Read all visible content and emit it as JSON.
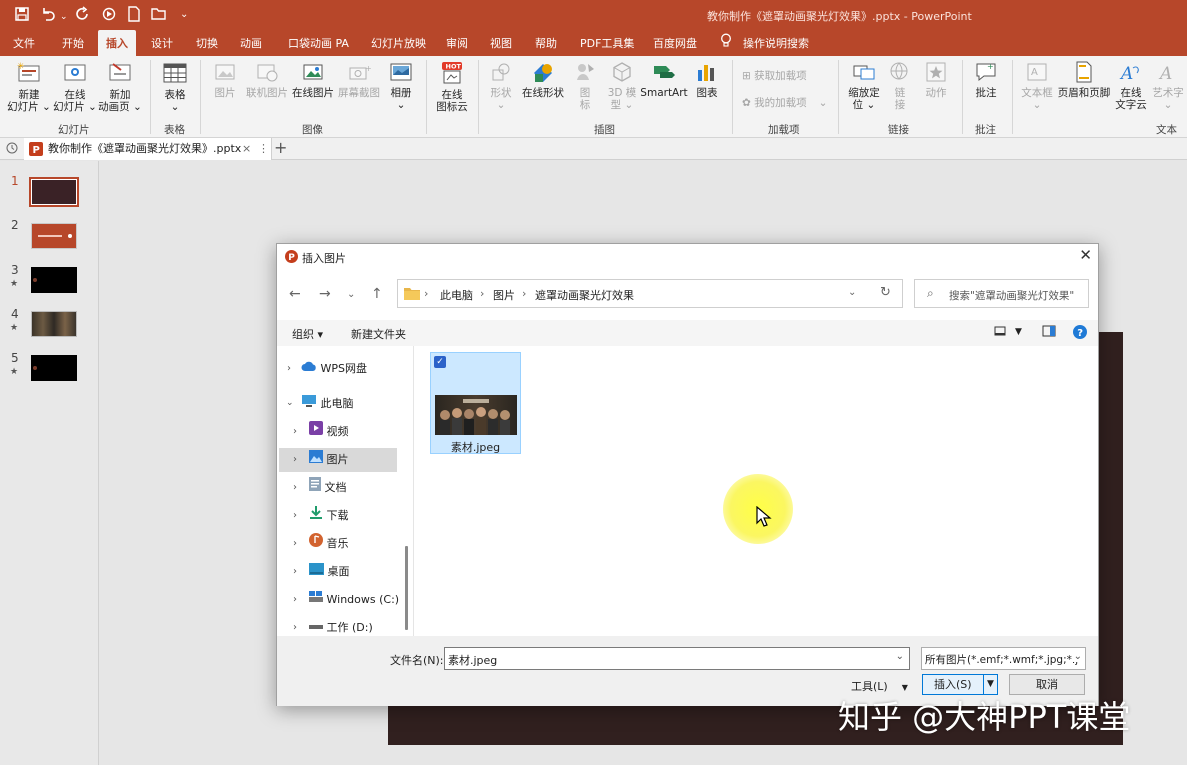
{
  "window": {
    "title": "教你制作《遮罩动画聚光灯效果》.pptx  -  PowerPoint",
    "accent": "#b7472a"
  },
  "quick_access": [
    {
      "icon": "save-icon",
      "glyph": "🖫"
    },
    {
      "icon": "undo-icon",
      "glyph": "↶"
    },
    {
      "icon": "redo-icon",
      "glyph": "↻"
    },
    {
      "icon": "from-beginning-icon",
      "glyph": "⟲"
    },
    {
      "icon": "new-file-icon",
      "glyph": "🗋"
    },
    {
      "icon": "open-folder-icon",
      "glyph": "🗁"
    },
    {
      "icon": "customize-icon",
      "glyph": "⌄"
    }
  ],
  "tabs": [
    "文件",
    "开始",
    "插入",
    "设计",
    "切换",
    "动画",
    "口袋动画 PA",
    "幻灯片放映",
    "审阅",
    "视图",
    "帮助",
    "PDF工具集",
    "百度网盘",
    "操作说明搜索"
  ],
  "active_tab": "插入",
  "ribbon": {
    "buttons": {
      "new_slide": "新建\n幻灯片 ⌄",
      "online_slide": "在线\n幻灯片 ⌄",
      "new_anim_page": "新加\n动画页 ⌄",
      "table": "表格\n⌄",
      "picture": "图片",
      "online_picture_linked": "联机图片",
      "online_picture": "在线图片",
      "screenshot": "屏幕截图",
      "album": "相册\n⌄",
      "online_icon_cloud": "在线\n图标云",
      "shapes": "形状\n⌄",
      "online_shapes": "在线形状",
      "icons": "图\n标",
      "model3d": "3D 模\n型 ⌄",
      "smartart": "SmartArt",
      "chart": "图表",
      "get_addins": "获取加载项",
      "my_addins": "我的加载项",
      "zoom": "缩放定\n位 ⌄",
      "link": "链\n接",
      "action": "动作",
      "comment": "批注",
      "textbox": "文本框\n⌄",
      "header_footer": "页眉和页脚",
      "online_wordart": "在线\n文字云",
      "wordart": "艺术字\n⌄"
    },
    "groups": [
      "幻灯片",
      "表格",
      "图像",
      "插图",
      "加载项",
      "链接",
      "批注",
      "文本"
    ],
    "hot_badge": "HOT"
  },
  "document_tab": {
    "label": "教你制作《遮罩动画聚光灯效果》.pptx",
    "close": "×",
    "more": "⋮",
    "add": "+"
  },
  "slides": [
    {
      "num": "1",
      "star": ""
    },
    {
      "num": "2",
      "star": ""
    },
    {
      "num": "3",
      "star": "★"
    },
    {
      "num": "4",
      "star": "★"
    },
    {
      "num": "5",
      "star": "★"
    }
  ],
  "dialog": {
    "title": "插入图片",
    "close": "✕",
    "path": [
      "此电脑",
      "图片",
      "遮罩动画聚光灯效果"
    ],
    "search_placeholder": "搜索\"遮罩动画聚光灯效果\"",
    "organize": "组织 ▾",
    "new_folder": "新建文件夹",
    "nav": [
      {
        "label": "WPS网盘",
        "icon": "cloud-icon"
      },
      {
        "label": "此电脑",
        "icon": "computer-icon"
      },
      {
        "label": "视频",
        "icon": "video-folder-icon"
      },
      {
        "label": "图片",
        "icon": "pictures-folder-icon"
      },
      {
        "label": "文档",
        "icon": "documents-folder-icon"
      },
      {
        "label": "下载",
        "icon": "downloads-icon"
      },
      {
        "label": "音乐",
        "icon": "music-icon"
      },
      {
        "label": "桌面",
        "icon": "desktop-icon"
      },
      {
        "label": "Windows (C:)",
        "icon": "drive-c-icon"
      },
      {
        "label": "工作 (D:)",
        "icon": "drive-d-icon"
      }
    ],
    "file": {
      "name": "素材.jpeg"
    },
    "filename_label": "文件名(N):",
    "filename_value": "素材.jpeg",
    "filetype": "所有图片(*.emf;*.wmf;*.jpg;*.j",
    "tools": "工具(L)",
    "insert": "插入(S)",
    "cancel": "取消"
  },
  "watermark": "知乎 @大神PPT课堂"
}
